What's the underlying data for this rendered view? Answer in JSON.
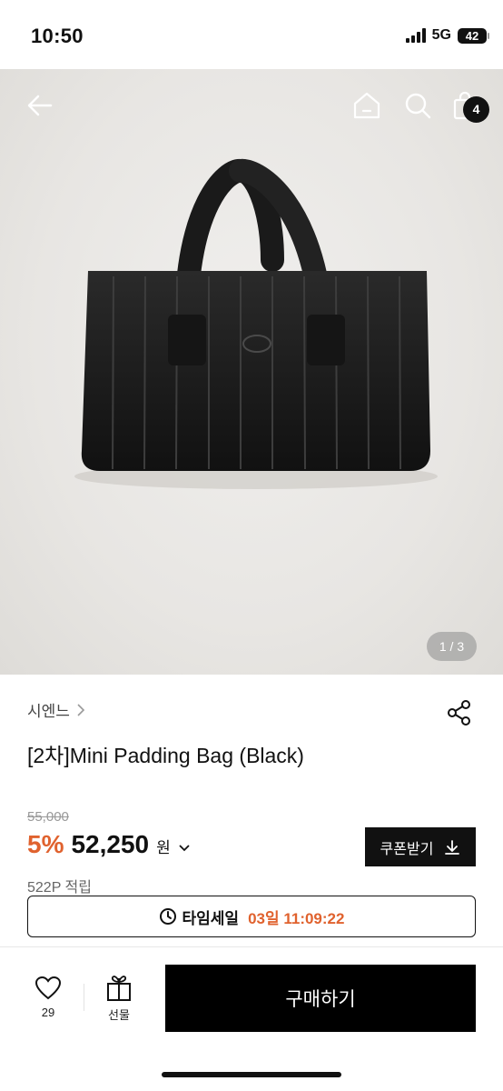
{
  "status": {
    "time": "10:50",
    "network": "5G",
    "battery": "42"
  },
  "header": {
    "cart_count": "4",
    "icons": [
      "back-arrow-icon",
      "home-icon",
      "search-icon",
      "shopping-bag-icon"
    ]
  },
  "gallery": {
    "indicator": "1 / 3"
  },
  "product": {
    "brand": "시엔느",
    "title": "[2차]Mini Padding Bag (Black)",
    "original_price": "55,000",
    "discount": "5%",
    "sale_price": "52,250",
    "currency": "원",
    "points": "522P 적립"
  },
  "coupon": {
    "label": "쿠폰받기"
  },
  "time_sale": {
    "label": "타임세일",
    "remaining": "03일 11:09:22"
  },
  "bottom_bar": {
    "like_count": "29",
    "gift_label": "선물",
    "buy_label": "구매하기"
  },
  "colors": {
    "accent": "#e0622e",
    "primary": "#000000"
  }
}
